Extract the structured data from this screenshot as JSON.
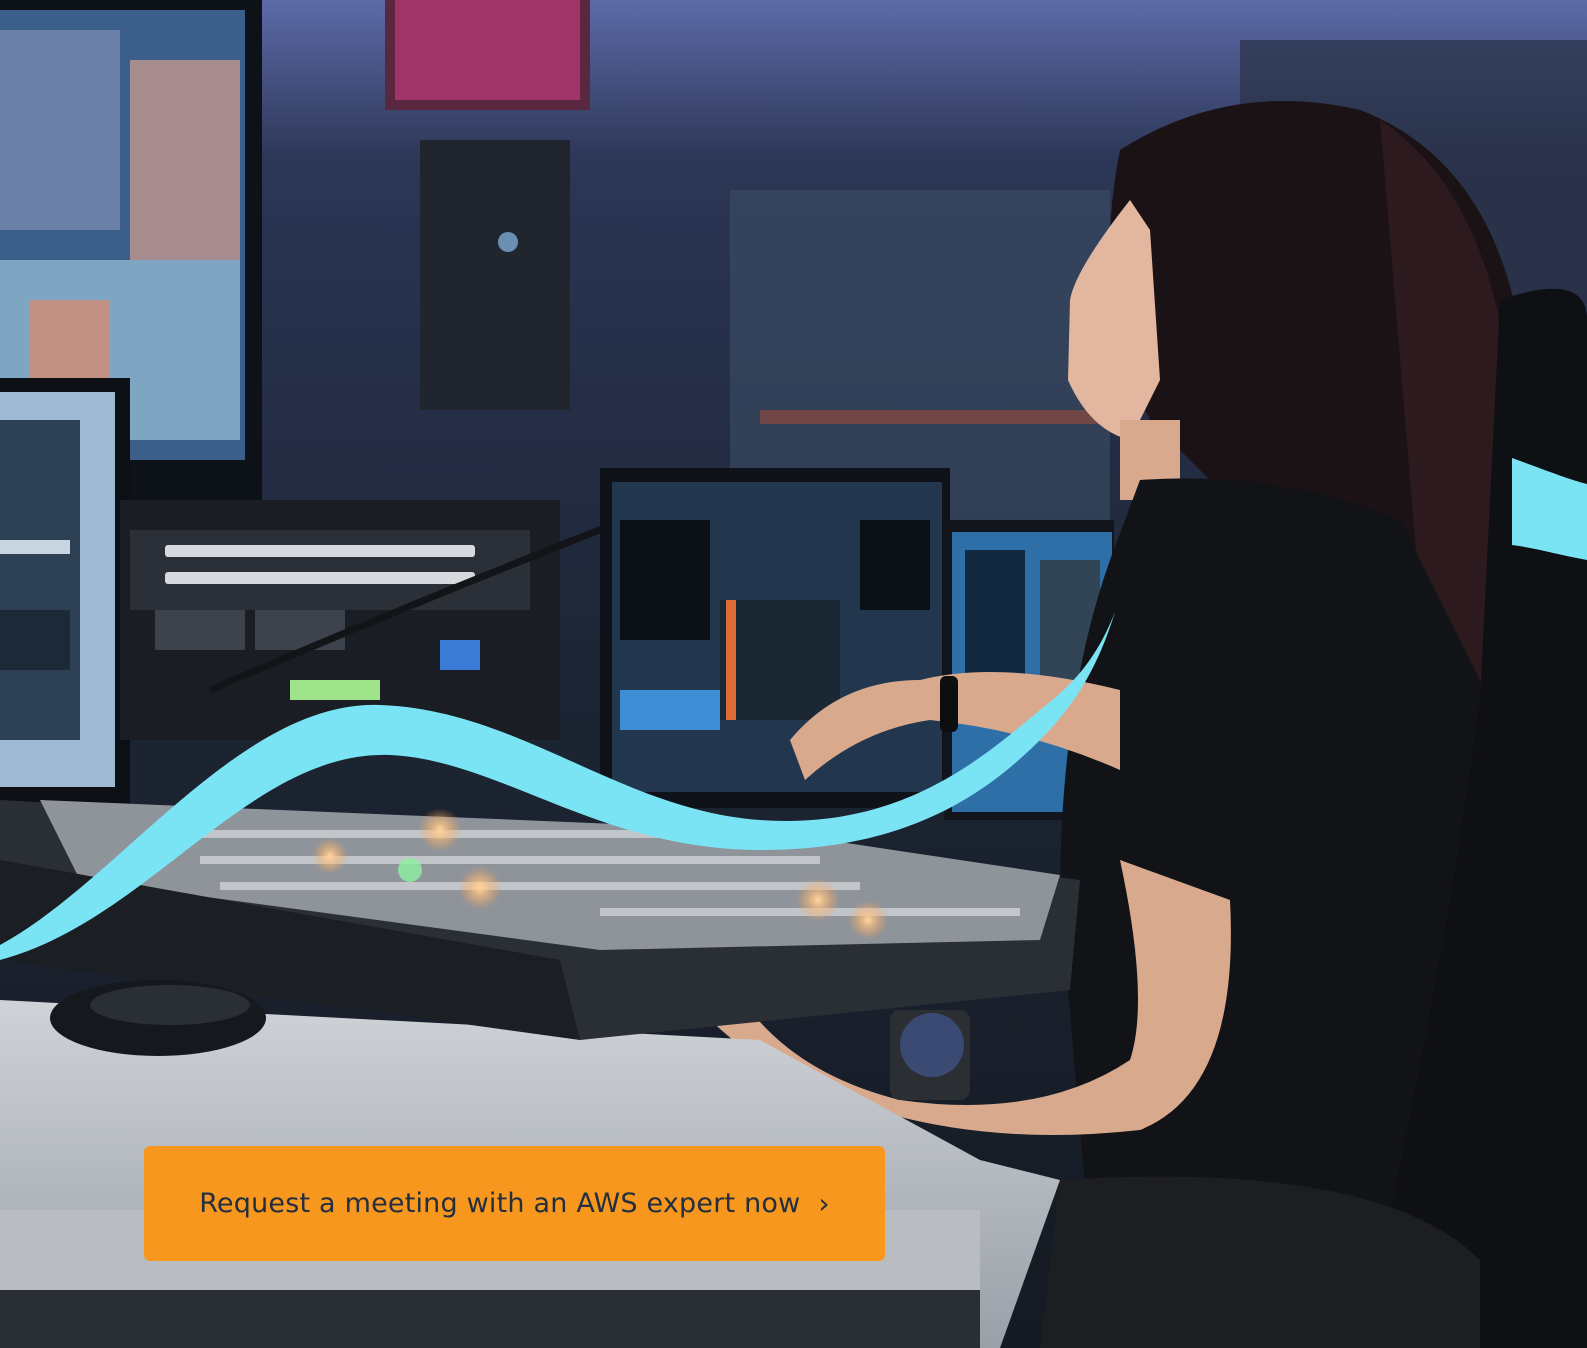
{
  "hero": {
    "image_icon": "photo-of-woman-at-broadcast-control-desk",
    "wave_color": "#7ae4f5"
  },
  "cta": {
    "label": "Request a meeting with an AWS expert now",
    "chevron": "›",
    "background": "#f7971e",
    "text_color": "#232f3e"
  }
}
